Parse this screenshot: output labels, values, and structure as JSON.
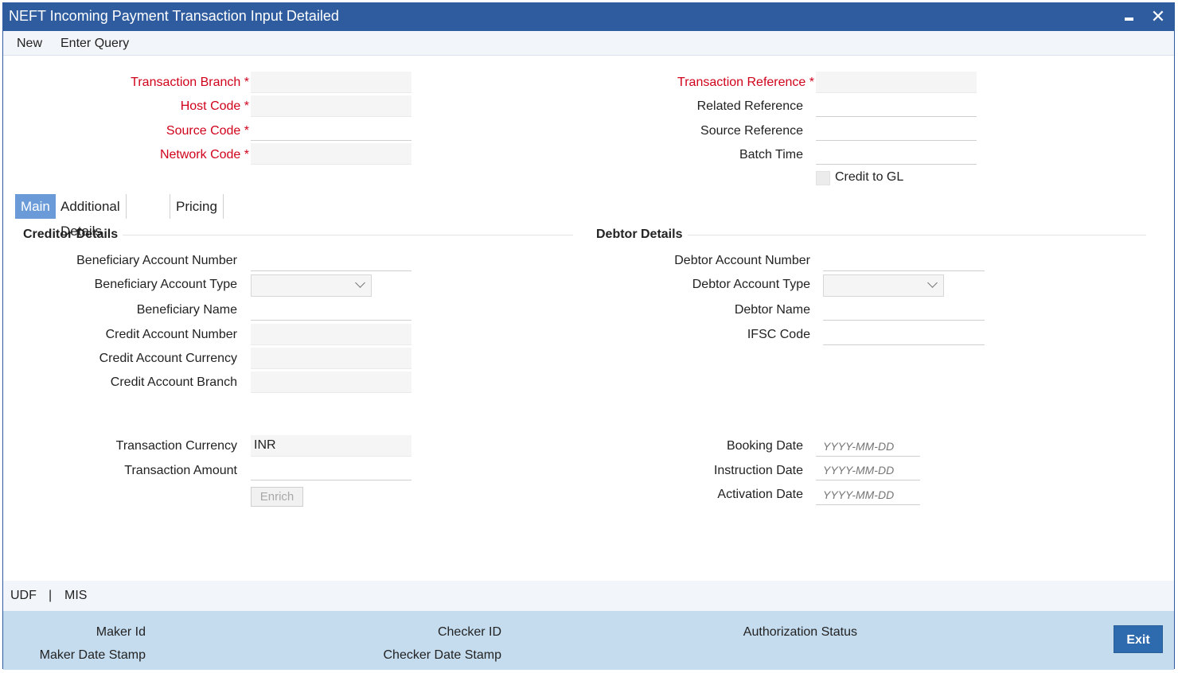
{
  "window": {
    "title": "NEFT Incoming Payment Transaction Input Detailed",
    "minimize_icon": "minimize-icon",
    "close_icon": "close-icon",
    "close_glyph": "✕"
  },
  "menu": {
    "new": "New",
    "enter_query": "Enter Query"
  },
  "header": {
    "transaction_branch": "Transaction Branch",
    "host_code": "Host Code",
    "source_code": "Source Code",
    "network_code": "Network Code",
    "transaction_reference": "Transaction Reference",
    "related_reference": "Related Reference",
    "source_reference": "Source Reference",
    "batch_time": "Batch Time",
    "credit_to_gl": "Credit to GL",
    "required_marker": "*"
  },
  "tabs": {
    "main": "Main",
    "additional": "Additional Details",
    "pricing": "Pricing"
  },
  "creditor": {
    "title": "Creditor Details",
    "beneficiary_account_number": "Beneficiary Account Number",
    "beneficiary_account_type": "Beneficiary Account Type",
    "beneficiary_name": "Beneficiary Name",
    "credit_account_number": "Credit Account Number",
    "credit_account_currency": "Credit Account Currency",
    "credit_account_branch": "Credit Account Branch"
  },
  "debtor": {
    "title": "Debtor Details",
    "debtor_account_number": "Debtor Account Number",
    "debtor_account_type": "Debtor Account Type",
    "debtor_name": "Debtor Name",
    "ifsc_code": "IFSC Code"
  },
  "transaction": {
    "currency_label": "Transaction Currency",
    "currency_value": "INR",
    "amount_label": "Transaction Amount",
    "enrich_button": "Enrich"
  },
  "dates": {
    "booking_date": "Booking Date",
    "instruction_date": "Instruction Date",
    "activation_date": "Activation Date",
    "placeholder": "YYYY-MM-DD"
  },
  "links": {
    "udf": "UDF",
    "separator": "|",
    "mis": "MIS"
  },
  "footer": {
    "maker_id": "Maker Id",
    "maker_date_stamp": "Maker Date Stamp",
    "checker_id": "Checker ID",
    "checker_date_stamp": "Checker Date Stamp",
    "authorization_status": "Authorization Status",
    "exit_button": "Exit"
  },
  "colors": {
    "titlebar": "#2e5c9e",
    "required_label": "#d0021b",
    "active_tab": "#6a9bd8",
    "footer": "#c5dcef",
    "exit_button": "#2e6bae"
  }
}
